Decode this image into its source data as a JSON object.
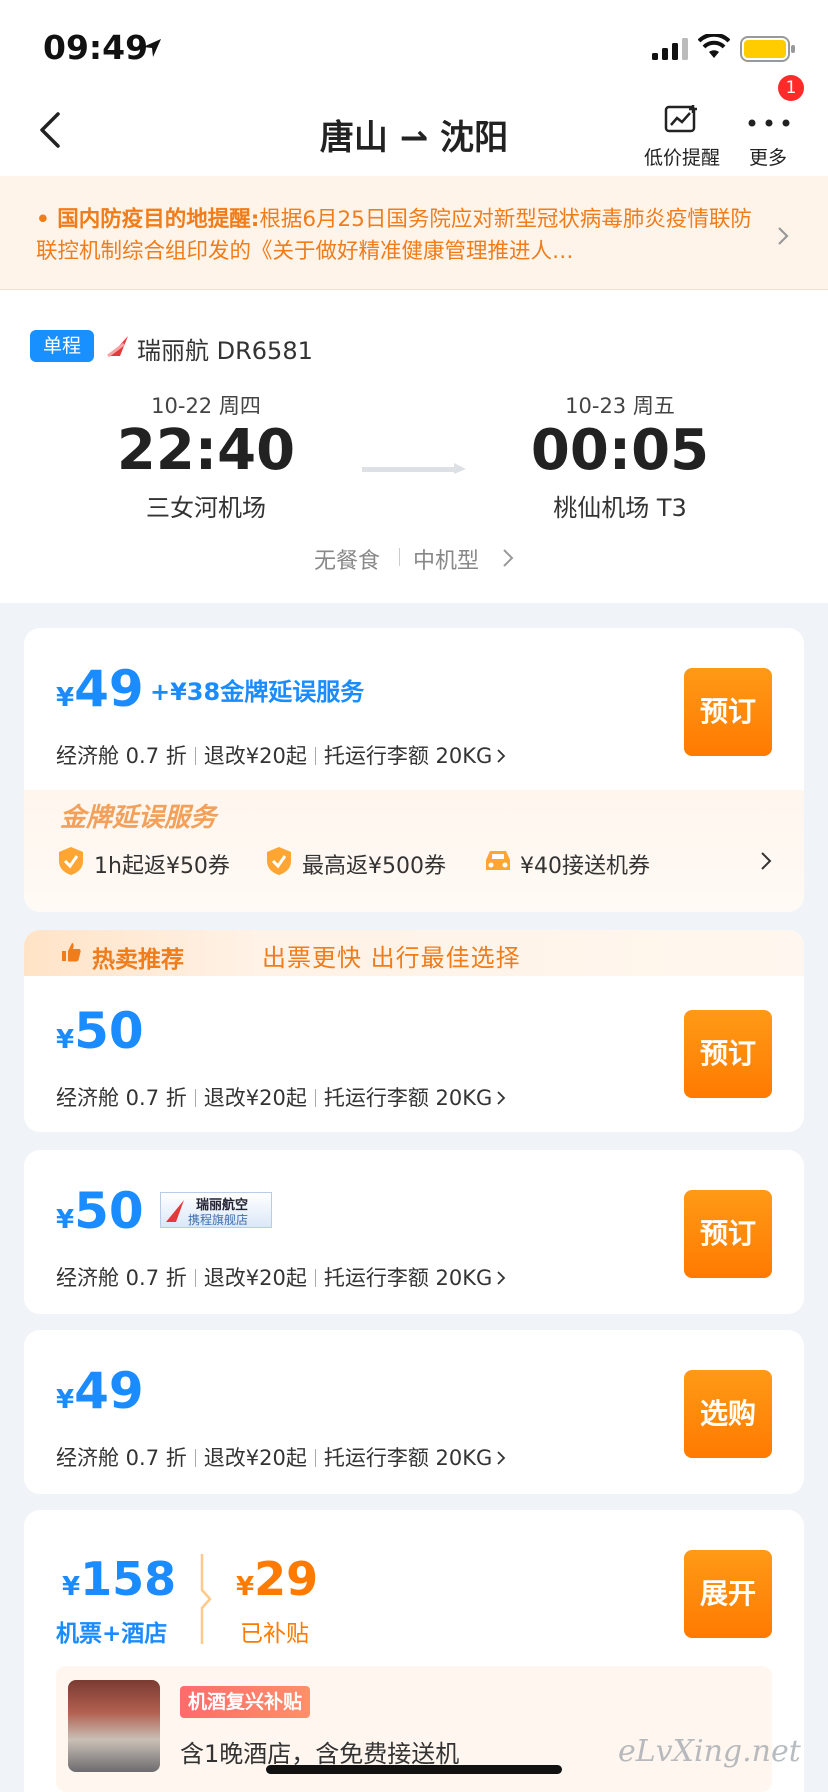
{
  "status": {
    "time": "09:49"
  },
  "nav": {
    "title": "唐山 ⇀ 沈阳",
    "low_price_alert": "低价提醒",
    "more": "更多",
    "more_badge": "1"
  },
  "notice": {
    "label": "• 国内防疫目的地提醒:",
    "text": "根据6月25日国务院应对新型冠状病毒肺炎疫情联防联控机制综合组印发的《关于做好精准健康管理推进人…"
  },
  "flight": {
    "trip_type": "单程",
    "airline": "瑞丽航 DR6581",
    "dep": {
      "date": "10-22 周四",
      "time": "22:40",
      "airport": "三女河机场"
    },
    "arr": {
      "date": "10-23 周五",
      "time": "00:05",
      "airport": "桃仙机场 T3"
    },
    "meal": "无餐食",
    "aircraft": "中机型"
  },
  "offers": [
    {
      "yen": "¥",
      "price": "49",
      "extra": "+¥38金牌延误服务",
      "cabin": "经济舱 0.7 折",
      "refund": "退改¥20起",
      "baggage": "托运行李额 20KG",
      "button": "预订"
    },
    {
      "yen": "¥",
      "price": "50",
      "cabin": "经济舱 0.7 折",
      "refund": "退改¥20起",
      "baggage": "托运行李额 20KG",
      "button": "预订"
    },
    {
      "yen": "¥",
      "price": "50",
      "cabin": "经济舱 0.7 折",
      "refund": "退改¥20起",
      "baggage": "托运行李额 20KG",
      "button": "预订",
      "store_name": "瑞丽航空",
      "store_sub": "携程旗舰店"
    },
    {
      "yen": "¥",
      "price": "49",
      "cabin": "经济舱 0.7 折",
      "refund": "退改¥20起",
      "baggage": "托运行李额 20KG",
      "button": "选购"
    }
  ],
  "gold_service": {
    "title": "金牌延误服务",
    "perks": [
      "1h起返¥50券",
      "最高返¥500券",
      "¥40接送机券"
    ]
  },
  "hot": {
    "label": "热卖推荐",
    "sub": "出票更快  出行最佳选择"
  },
  "combo": {
    "yen": "¥",
    "price": "158",
    "label": "机票+酒店",
    "sub_yen": "¥",
    "sub_price": "29",
    "sub_label": "已补贴",
    "button": "展开",
    "hotel_tag": "机酒复兴补贴",
    "hotel_desc": "含1晚酒店，含免费接送机"
  },
  "watermark": "eLvXing.net",
  "colors": {
    "accent": "#1a8cff",
    "orange": "#ff7a00",
    "badge_red": "#ff2a2a"
  }
}
